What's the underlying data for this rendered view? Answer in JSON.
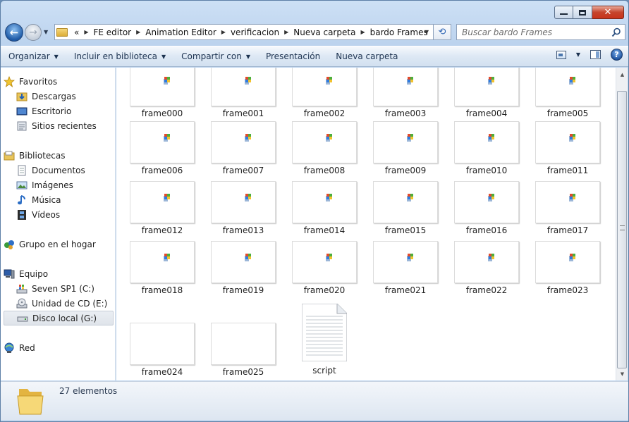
{
  "window": {
    "minimize_label": "",
    "close_glyph": "✕"
  },
  "address": {
    "overflow": "«",
    "crumbs": [
      "FE editor",
      "Animation Editor",
      "verificacion",
      "Nueva carpeta",
      "bardo Frames"
    ]
  },
  "search": {
    "placeholder": "Buscar bardo Frames"
  },
  "toolbar": {
    "organize": "Organizar",
    "include": "Incluir en biblioteca",
    "share": "Compartir con",
    "slideshow": "Presentación",
    "new_folder": "Nueva carpeta"
  },
  "sidebar": {
    "favorites": "Favoritos",
    "downloads": "Descargas",
    "desktop": "Escritorio",
    "recent": "Sitios recientes",
    "libraries": "Bibliotecas",
    "documents": "Documentos",
    "images": "Imágenes",
    "music": "Música",
    "videos": "Vídeos",
    "homegroup": "Grupo en el hogar",
    "computer": "Equipo",
    "drive_c": "Seven SP1 (C:)",
    "drive_e": "Unidad de CD (E:)",
    "drive_g": "Disco local (G:)",
    "network": "Red"
  },
  "files": [
    "frame000",
    "frame001",
    "frame002",
    "frame003",
    "frame004",
    "frame005",
    "frame006",
    "frame007",
    "frame008",
    "frame009",
    "frame010",
    "frame011",
    "frame012",
    "frame013",
    "frame014",
    "frame015",
    "frame016",
    "frame017",
    "frame018",
    "frame019",
    "frame020",
    "frame021",
    "frame022",
    "frame023",
    "frame024",
    "frame025",
    "script"
  ],
  "status": {
    "count": "27 elementos"
  },
  "colors": {
    "accent": "#2d64b3",
    "selected": "#dfe4ea"
  }
}
